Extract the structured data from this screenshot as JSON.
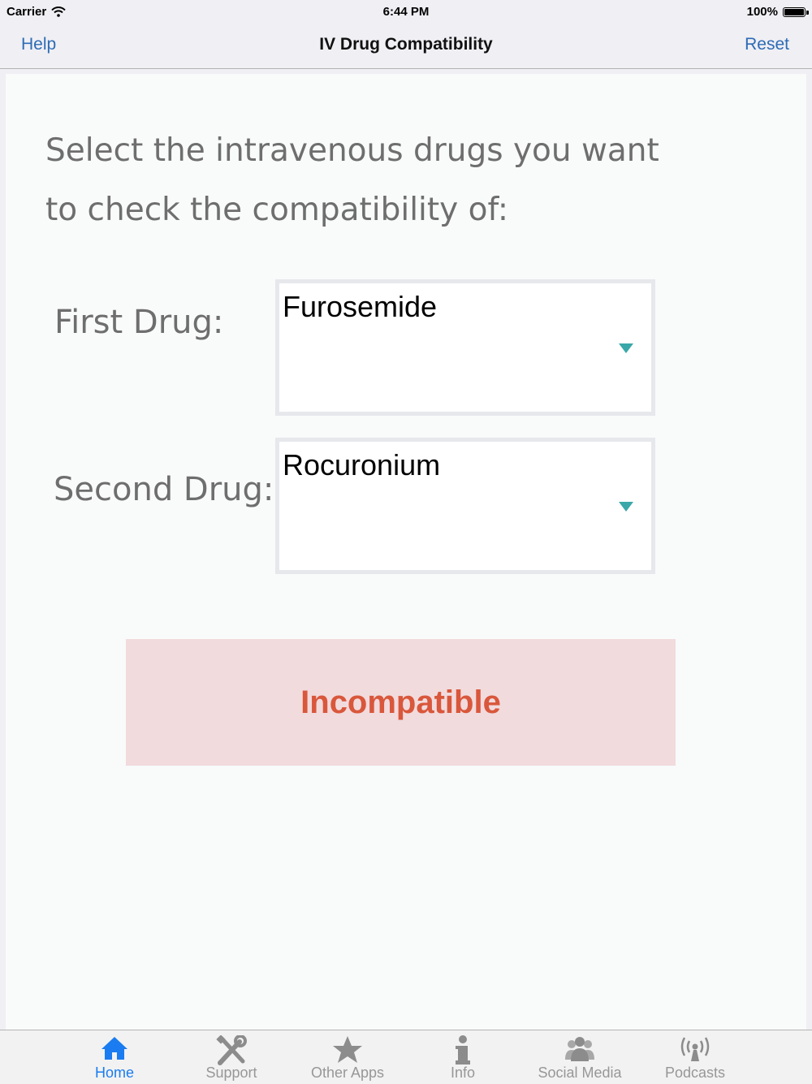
{
  "status_bar": {
    "carrier": "Carrier",
    "time": "6:44 PM",
    "battery": "100%"
  },
  "nav": {
    "left_button": "Help",
    "title": "IV Drug Compatibility",
    "right_button": "Reset"
  },
  "main": {
    "prompt": "Select the intravenous drugs you want to check the compatibility of:",
    "first_drug": {
      "label": "First Drug:",
      "value": "Furosemide"
    },
    "second_drug": {
      "label": "Second Drug:",
      "value": "Rocuronium"
    },
    "result": "Incompatible"
  },
  "tabs": [
    {
      "label": "Home",
      "icon": "home-icon",
      "active": true
    },
    {
      "label": "Support",
      "icon": "tools-icon",
      "active": false
    },
    {
      "label": "Other Apps",
      "icon": "star-icon",
      "active": false
    },
    {
      "label": "Info",
      "icon": "info-icon",
      "active": false
    },
    {
      "label": "Social Media",
      "icon": "people-icon",
      "active": false
    },
    {
      "label": "Podcasts",
      "icon": "podcast-icon",
      "active": false
    }
  ],
  "colors": {
    "accent": "#2e6bb5",
    "tab_active": "#1a7cf0",
    "result_bg": "#f1dbdd",
    "result_text": "#d9573b",
    "picker_arrow": "#3aa8a8"
  }
}
